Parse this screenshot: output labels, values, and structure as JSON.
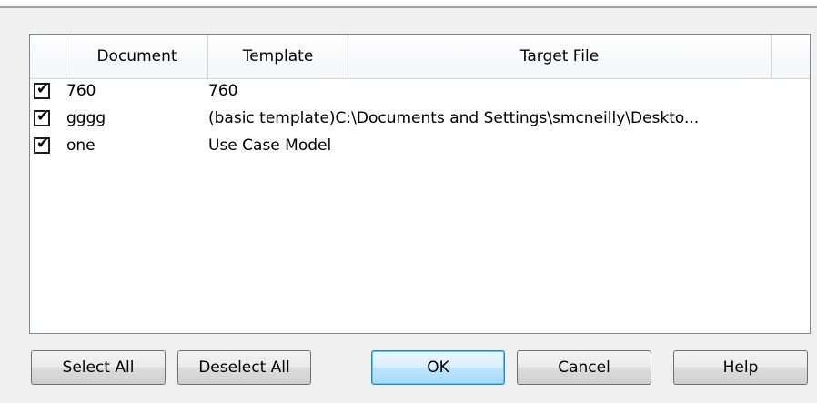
{
  "columns": {
    "document": "Document",
    "template": "Template",
    "target_file": "Target File"
  },
  "rows": [
    {
      "checked": true,
      "document": "760",
      "template": "760"
    },
    {
      "checked": true,
      "document": "gggg",
      "template": "(basic template)C:\\Documents and Settings\\smcneilly\\Deskto..."
    },
    {
      "checked": true,
      "document": "one",
      "template": "Use Case Model"
    }
  ],
  "buttons": {
    "select_all": "Select All",
    "deselect_all": "Deselect All",
    "ok": "OK",
    "cancel": "Cancel",
    "help": "Help"
  }
}
